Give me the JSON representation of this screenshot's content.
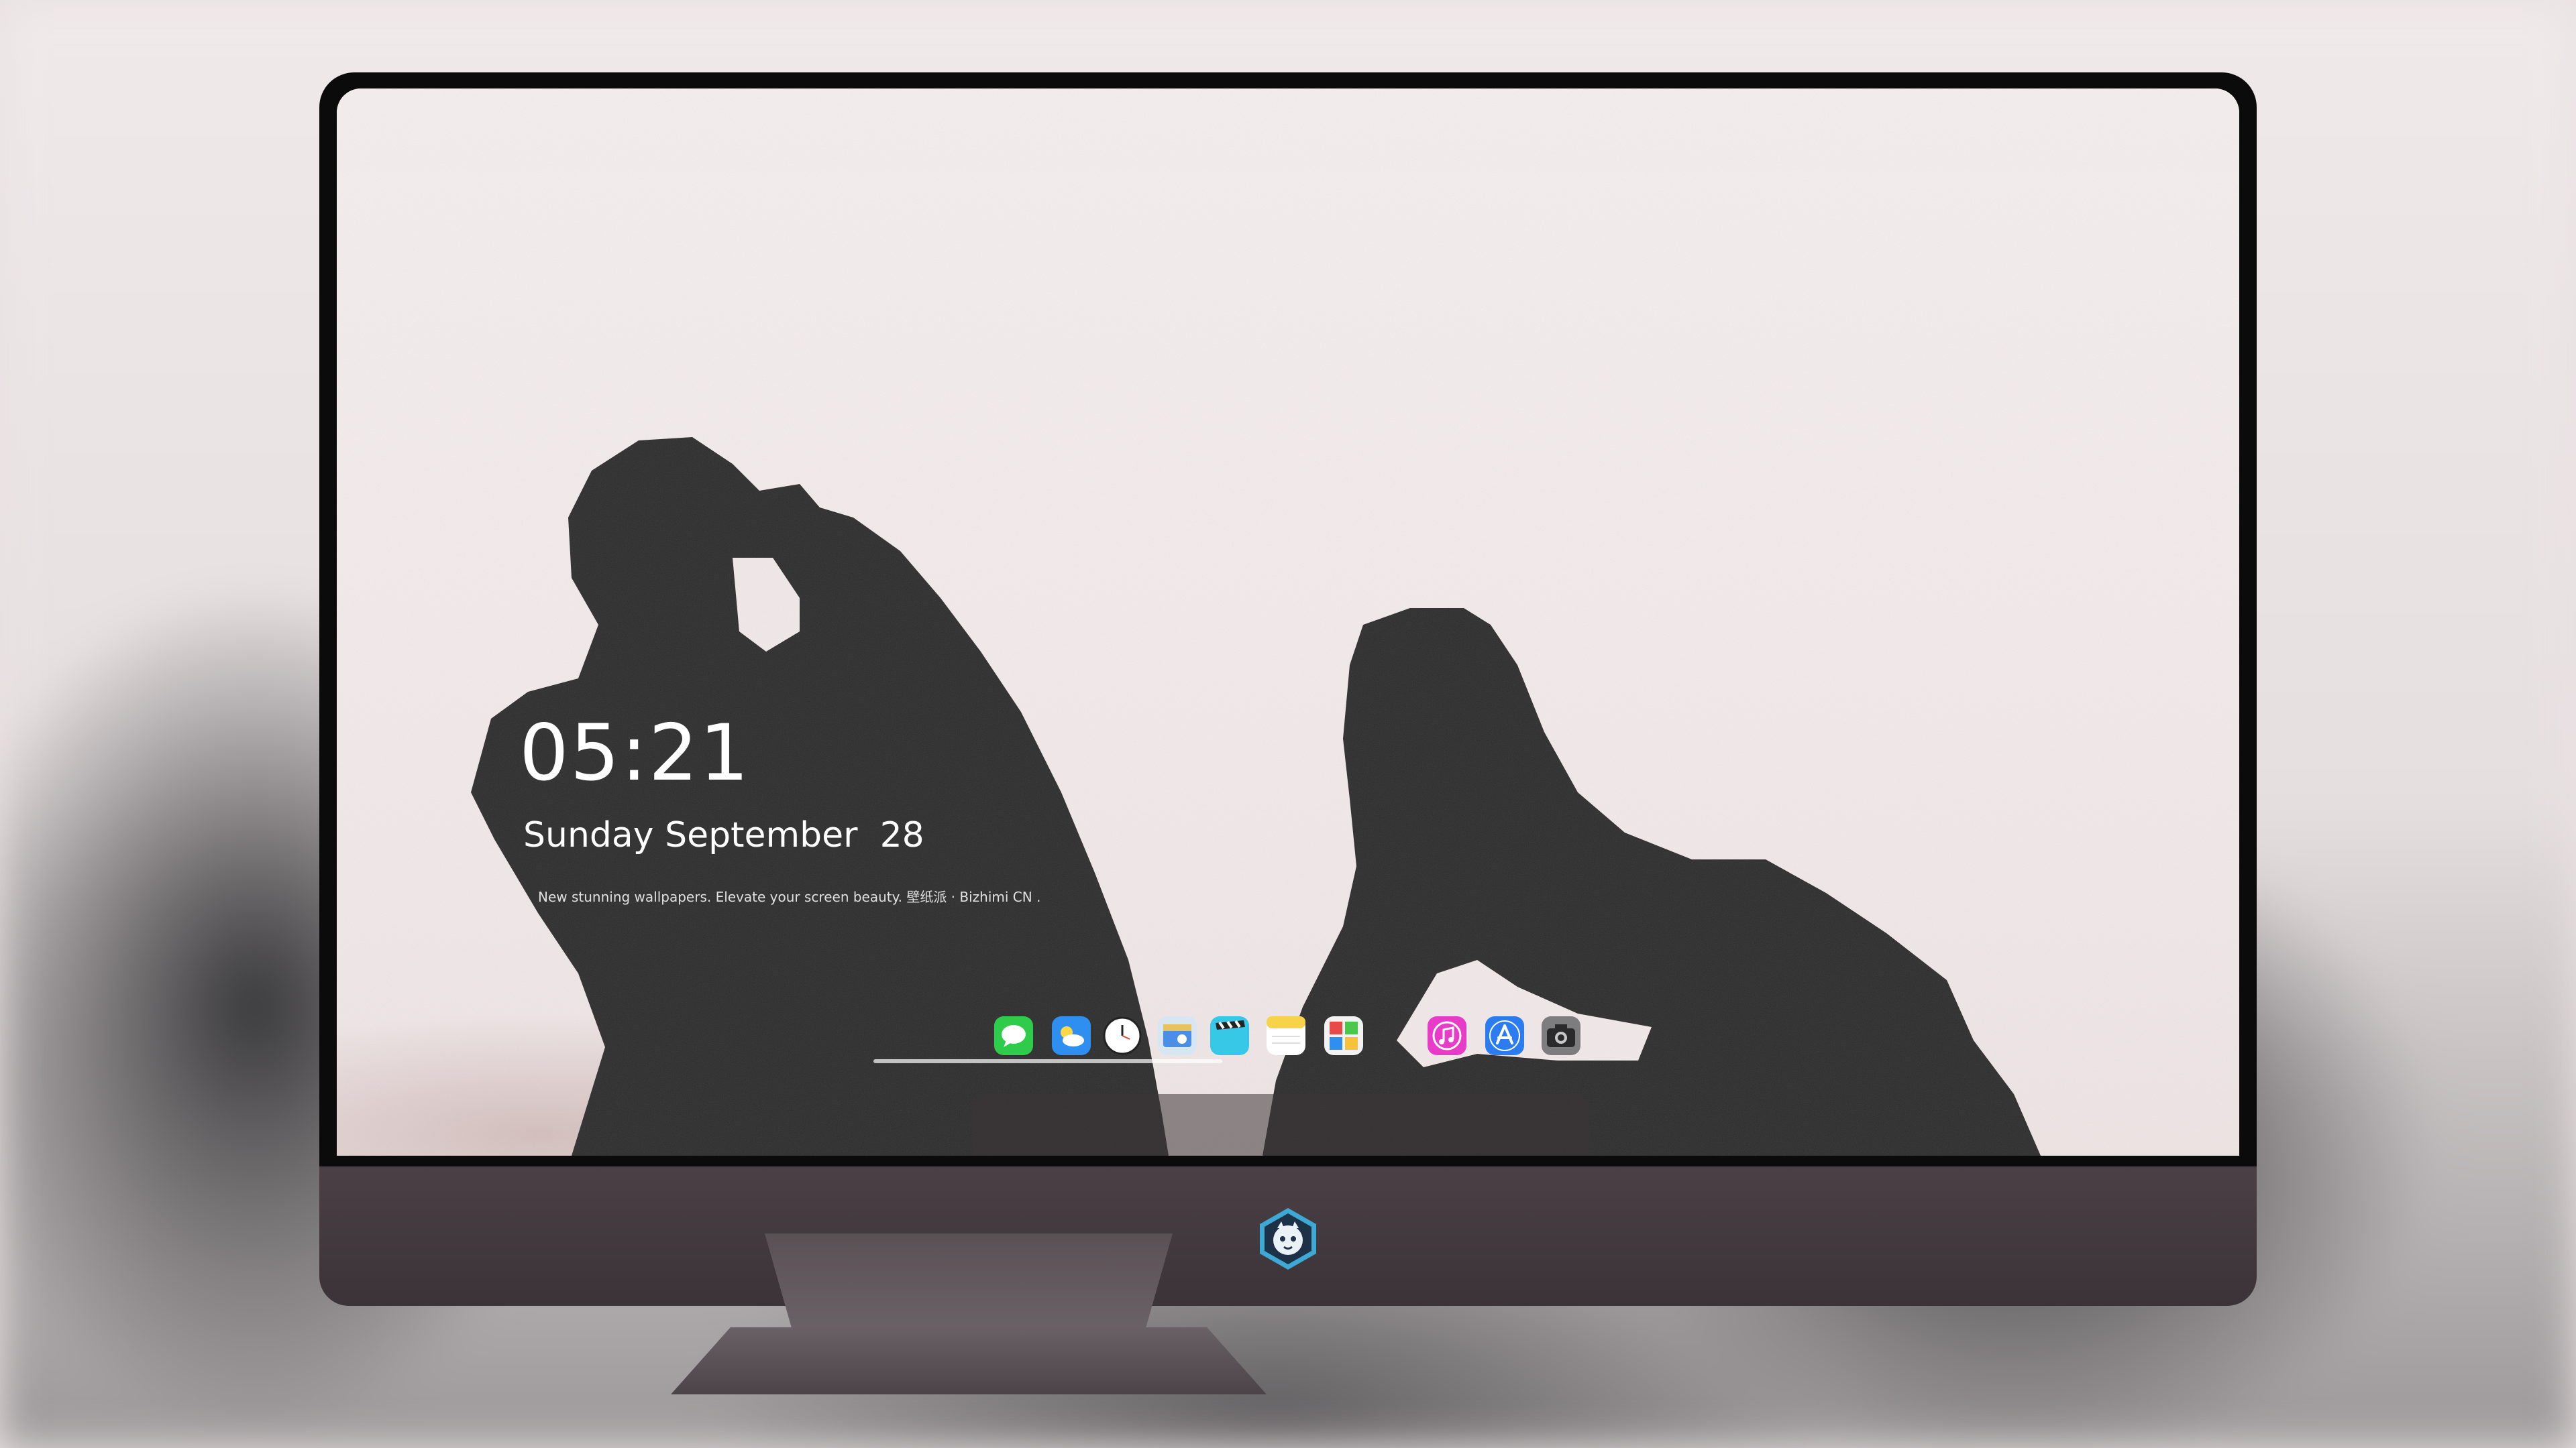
{
  "clock": {
    "time": "05:21",
    "date": "Sunday September  28",
    "caption": "New stunning wallpapers. Elevate your screen beauty. 壁纸派 · Bizhimi CN ."
  },
  "dock": {
    "items": [
      {
        "name": "messages",
        "icon": "speech-bubble-icon",
        "color": "#2ecc4a"
      },
      {
        "name": "weather",
        "icon": "cloud-icon",
        "color": "#2f8ff0"
      },
      {
        "name": "clock",
        "icon": "clock-icon",
        "color": "#ffffff"
      },
      {
        "name": "preview",
        "icon": "photo-viewer-icon",
        "color": "#e8c25a"
      },
      {
        "name": "clips",
        "icon": "clapperboard-icon",
        "color": "#37c8e8"
      },
      {
        "name": "notes",
        "icon": "notepad-icon",
        "color": "#f7d34a"
      },
      {
        "name": "photo-booth",
        "icon": "photo-grid-icon",
        "color": "#e84a4a"
      },
      {
        "name": "music",
        "icon": "music-note-icon",
        "color": "#e83cc8"
      },
      {
        "name": "app-store",
        "icon": "app-store-icon",
        "color": "#2a7cf0"
      },
      {
        "name": "camera",
        "icon": "camera-icon",
        "color": "#7d7d80"
      }
    ]
  },
  "monitor": {
    "logo": "dragon-mascot-logo"
  }
}
